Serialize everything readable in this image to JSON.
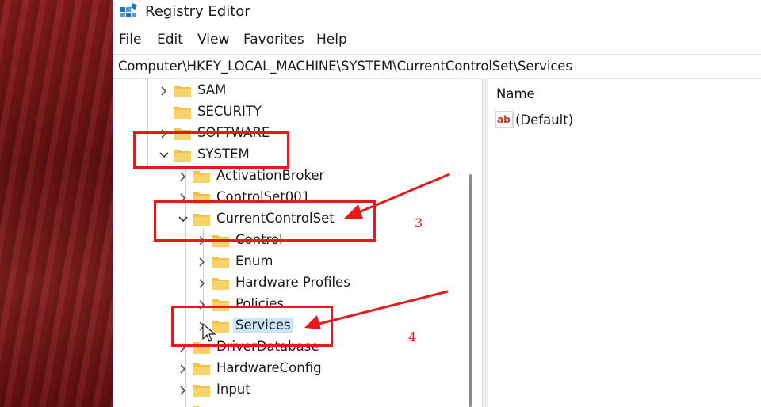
{
  "window": {
    "title": "Registry Editor"
  },
  "menu": [
    "File",
    "Edit",
    "View",
    "Favorites",
    "Help"
  ],
  "address": "Computer\\HKEY_LOCAL_MACHINE\\SYSTEM\\CurrentControlSet\\Services",
  "tree": [
    {
      "label": "SAM",
      "expanded": false
    },
    {
      "label": "SECURITY",
      "expanded": false
    },
    {
      "label": "SOFTWARE",
      "expanded": false
    },
    {
      "label": "SYSTEM",
      "expanded": true
    },
    {
      "label": "ActivationBroker",
      "expanded": false
    },
    {
      "label": "ControlSet001",
      "expanded": false
    },
    {
      "label": "CurrentControlSet",
      "expanded": true
    },
    {
      "label": "Control",
      "expanded": false
    },
    {
      "label": "Enum",
      "expanded": false
    },
    {
      "label": "Hardware Profiles",
      "expanded": false
    },
    {
      "label": "Policies",
      "expanded": false
    },
    {
      "label": "Services",
      "expanded": false,
      "selected": true
    },
    {
      "label": "DriverDatabase",
      "expanded": false
    },
    {
      "label": "HardwareConfig",
      "expanded": false
    },
    {
      "label": "Input",
      "expanded": false
    }
  ],
  "values_pane": {
    "column_name": "Name",
    "entries": [
      {
        "icon": "string-value-icon",
        "name": "(Default)"
      }
    ]
  },
  "annotations": {
    "step3": "3",
    "step4": "4",
    "color": "#e8191b"
  },
  "colors": {
    "folder": "#f2c24f",
    "selection": "#cce4f7",
    "annotation": "#e8191b"
  }
}
